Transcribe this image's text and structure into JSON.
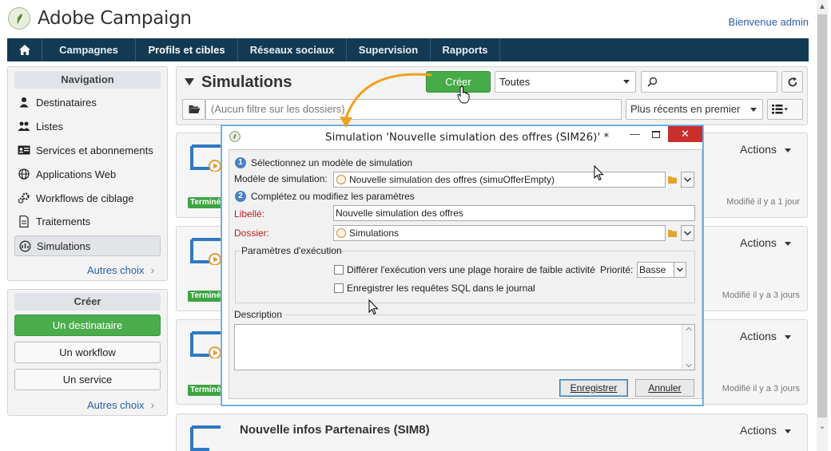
{
  "app": {
    "brand": "Adobe Campaign",
    "welcome": "Bienvenue admin"
  },
  "navbar": {
    "items": [
      "Campagnes",
      "Profils et cibles",
      "Réseaux sociaux",
      "Supervision",
      "Rapports"
    ],
    "active": "Profils et cibles"
  },
  "sidebar": {
    "nav_title": "Navigation",
    "items": [
      "Destinataires",
      "Listes",
      "Services et abonnements",
      "Applications Web",
      "Workflows de ciblage",
      "Traitements",
      "Simulations"
    ],
    "selected": "Simulations",
    "more": "Autres choix",
    "create_title": "Créer",
    "create_items": [
      "Un destinataire",
      "Un workflow",
      "Un service"
    ],
    "create_more": "Autres choix"
  },
  "main": {
    "title": "Simulations",
    "create_button": "Créer",
    "filter_select": "Toutes",
    "folder_filter_placeholder": "(Aucun filtre sur les dossiers)",
    "sort": "Plus récents en premier",
    "cards": [
      {
        "badge": "Terminé",
        "actions": "Actions",
        "modified": "Modifié il y a 1 jour"
      },
      {
        "badge": "Terminé",
        "actions": "Actions",
        "modified": "Modifié il y a 3 jours"
      },
      {
        "badge": "Terminé",
        "actions": "Actions",
        "modified": "Modifié il y a 3 jours"
      },
      {
        "title": "Nouvelle infos Partenaires (SIM8)",
        "actions": "Actions"
      }
    ]
  },
  "dialog": {
    "title": "Simulation 'Nouvelle simulation des offres (SIM26)' *",
    "step1_num": "1",
    "step1": "Sélectionnez un modèle de simulation",
    "model_label": "Modèle de simulation:",
    "model_value": "Nouvelle simulation des offres (simuOfferEmpty)",
    "step2_num": "2",
    "step2": "Complétez ou modifiez les paramètres",
    "libelle_label": "Libellé:",
    "libelle_value": "Nouvelle simulation des offres",
    "dossier_label": "Dossier:",
    "dossier_value": "Simulations",
    "exec_group": "Paramètres d'exécution",
    "exec_option1": "Différer l'exécution vers une plage horaire de faible activité",
    "priority_label": "Priorité:",
    "priority_value": "Basse",
    "exec_option2": "Enregistrer les requêtes SQL dans le journal",
    "description_label": "Description",
    "save": "Enregistrer",
    "cancel": "Annuler"
  },
  "colors": {
    "navbar": "#133a52",
    "green": "#47ab48",
    "close": "#c9302c",
    "accent_orange": "#f0a11d",
    "link": "#2a5ea8"
  }
}
